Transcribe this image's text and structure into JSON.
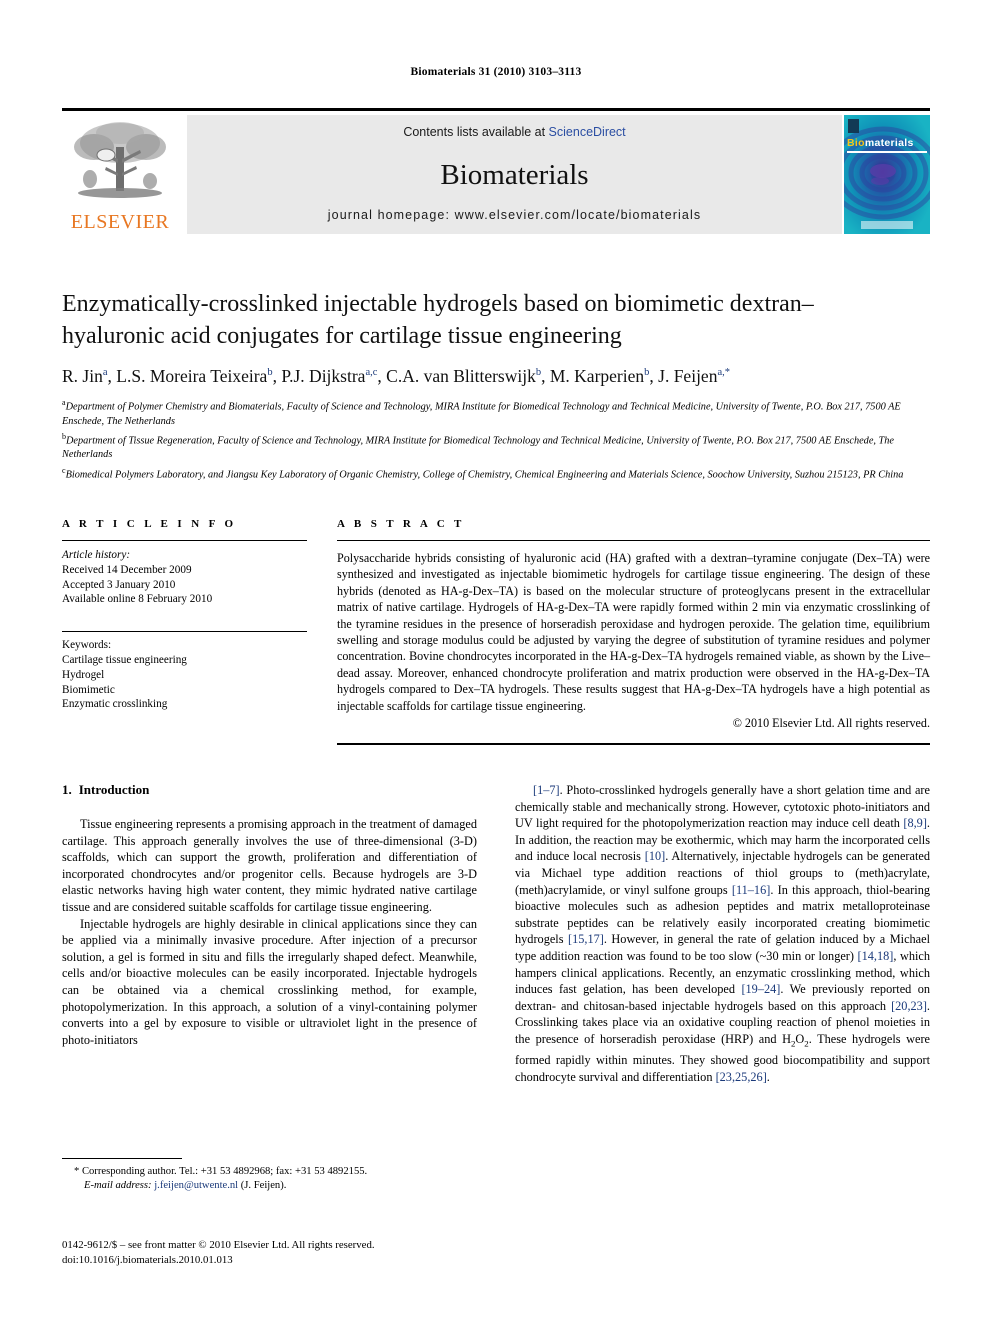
{
  "running_head": "Biomaterials 31 (2010) 3103–3113",
  "masthead": {
    "publisher_name": "ELSEVIER",
    "contents_prefix": "Contents lists available at ",
    "sciencedirect": "ScienceDirect",
    "journal_title": "Biomaterials",
    "homepage": "journal homepage: www.elsevier.com/locate/biomaterials",
    "cover_label_bio": "Bio",
    "cover_label_materials": "materials",
    "link_color": "#2b4ea2",
    "elsevier_orange": "#E87722",
    "cover_teal": "#0a9ab5"
  },
  "article": {
    "title": "Enzymatically-crosslinked injectable hydrogels based on biomimetic dextran–hyaluronic acid conjugates for cartilage tissue engineering",
    "authors": [
      {
        "name": "R. Jin",
        "sup": "a"
      },
      {
        "name": "L.S. Moreira Teixeira",
        "sup": "b"
      },
      {
        "name": "P.J. Dijkstra",
        "sup": "a,c"
      },
      {
        "name": "C.A. van Blitterswijk",
        "sup": "b"
      },
      {
        "name": "M. Karperien",
        "sup": "b"
      },
      {
        "name": "J. Feijen",
        "sup": "a,*"
      }
    ],
    "affiliations": [
      {
        "marker": "a",
        "text": "Department of Polymer Chemistry and Biomaterials, Faculty of Science and Technology, MIRA Institute for Biomedical Technology and Technical Medicine, University of Twente, P.O. Box 217, 7500 AE Enschede, The Netherlands"
      },
      {
        "marker": "b",
        "text": "Department of Tissue Regeneration, Faculty of Science and Technology, MIRA Institute for Biomedical Technology and Technical Medicine, University of Twente, P.O. Box 217, 7500 AE Enschede, The Netherlands"
      },
      {
        "marker": "c",
        "text": "Biomedical Polymers Laboratory, and Jiangsu Key Laboratory of Organic Chemistry, College of Chemistry, Chemical Engineering and Materials Science, Soochow University, Suzhou 215123, PR China"
      }
    ]
  },
  "article_info": {
    "heading": "A R T I C L E   I N F O",
    "history_label": "Article history:",
    "history": [
      "Received 14 December 2009",
      "Accepted 3 January 2010",
      "Available online 8 February 2010"
    ],
    "keywords_label": "Keywords:",
    "keywords": [
      "Cartilage tissue engineering",
      "Hydrogel",
      "Biomimetic",
      "Enzymatic crosslinking"
    ]
  },
  "abstract": {
    "heading": "A B S T R A C T",
    "text": "Polysaccharide hybrids consisting of hyaluronic acid (HA) grafted with a dextran–tyramine conjugate (Dex–TA) were synthesized and investigated as injectable biomimetic hydrogels for cartilage tissue engineering. The design of these hybrids (denoted as HA-g-Dex–TA) is based on the molecular structure of proteoglycans present in the extracellular matrix of native cartilage. Hydrogels of HA-g-Dex–TA were rapidly formed within 2 min via enzymatic crosslinking of the tyramine residues in the presence of horseradish peroxidase and hydrogen peroxide. The gelation time, equilibrium swelling and storage modulus could be adjusted by varying the degree of substitution of tyramine residues and polymer concentration. Bovine chondrocytes incorporated in the HA-g-Dex–TA hydrogels remained viable, as shown by the Live–dead assay. Moreover, enhanced chondrocyte proliferation and matrix production were observed in the HA-g-Dex–TA hydrogels compared to Dex–TA hydrogels. These results suggest that HA-g-Dex–TA hydrogels have a high potential as injectable scaffolds for cartilage tissue engineering.",
    "copyright": "© 2010 Elsevier Ltd. All rights reserved."
  },
  "body": {
    "section_number": "1.",
    "section_title": "Introduction",
    "left_paragraphs": [
      "Tissue engineering represents a promising approach in the treatment of damaged cartilage. This approach generally involves the use of three-dimensional (3-D) scaffolds, which can support the growth, proliferation and differentiation of incorporated chondrocytes and/or progenitor cells. Because hydrogels are 3-D elastic networks having high water content, they mimic hydrated native cartilage tissue and are considered suitable scaffolds for cartilage tissue engineering.",
      "Injectable hydrogels are highly desirable in clinical applications since they can be applied via a minimally invasive procedure. After injection of a precursor solution, a gel is formed in situ and fills the irregularly shaped defect. Meanwhile, cells and/or bioactive molecules can be easily incorporated. Injectable hydrogels can be obtained via a chemical crosslinking method, for example, photopolymerization. In this approach, a solution of a vinyl-containing polymer converts into a gel by exposure to visible or ultraviolet light in the presence of photo-initiators"
    ],
    "right_paragraph": "[1–7]. Photo-crosslinked hydrogels generally have a short gelation time and are chemically stable and mechanically strong. However, cytotoxic photo-initiators and UV light required for the photopolymerization reaction may induce cell death [8,9]. In addition, the reaction may be exothermic, which may harm the incorporated cells and induce local necrosis [10]. Alternatively, injectable hydrogels can be generated via Michael type addition reactions of thiol groups to (meth)acrylate, (meth)acrylamide, or vinyl sulfone groups [11–16]. In this approach, thiol-bearing bioactive molecules such as adhesion peptides and matrix metalloproteinase substrate peptides can be relatively easily incorporated creating biomimetic hydrogels [15,17]. However, in general the rate of gelation induced by a Michael type addition reaction was found to be too slow (~30 min or longer) [14,18], which hampers clinical applications. Recently, an enzymatic crosslinking method, which induces fast gelation, has been developed [19–24]. We previously reported on dextran- and chitosan-based injectable hydrogels based on this approach [20,23]. Crosslinking takes place via an oxidative coupling reaction of phenol moieties in the presence of horseradish peroxidase (HRP) and H2O2. These hydrogels were formed rapidly within minutes. They showed good biocompatibility and support chondrocyte survival and differentiation [23,25,26].",
    "reference_color": "#1b3a7a"
  },
  "footnotes": {
    "corresponding": "* Corresponding author. Tel.: +31 53 4892968; fax: +31 53 4892155.",
    "email_label": "E-mail address:",
    "email": "j.feijen@utwente.nl",
    "email_owner": "(J. Feijen)."
  },
  "imprint": {
    "line1": "0142-9612/$ – see front matter © 2010 Elsevier Ltd. All rights reserved.",
    "line2": "doi:10.1016/j.biomaterials.2010.01.013"
  }
}
